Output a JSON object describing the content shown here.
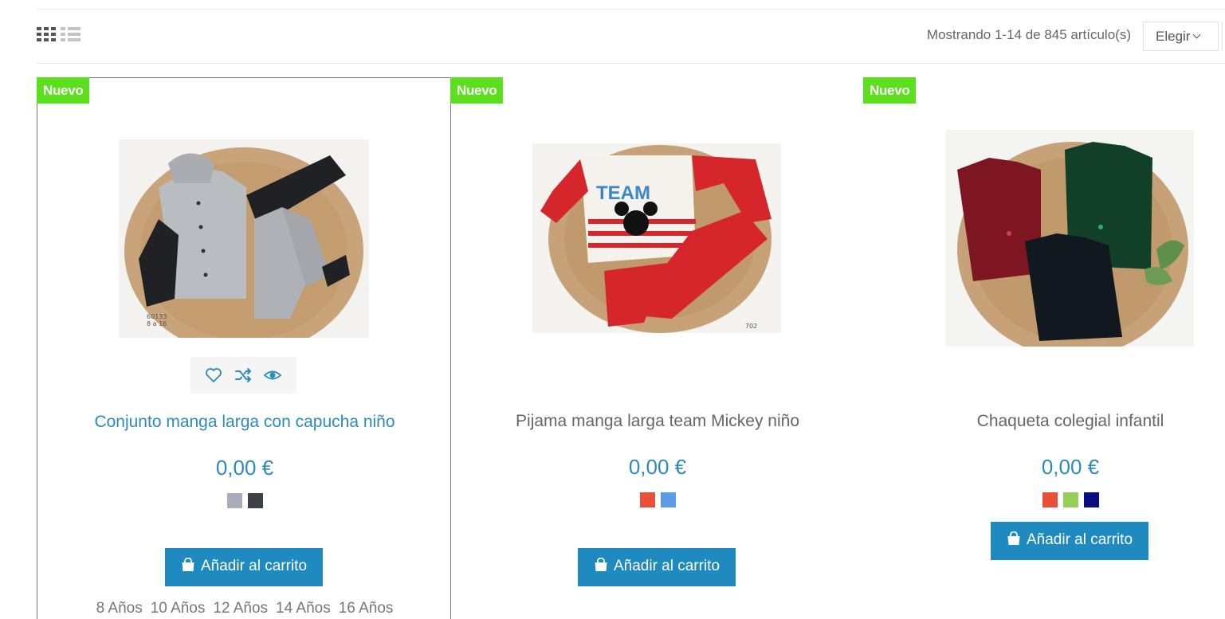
{
  "toolbar": {
    "showing_text": "Mostrando 1-14 de 845 artículo(s)",
    "sort_label": "Elegir",
    "grid_view_icon": "grid-view-icon",
    "list_view_icon": "list-view-icon"
  },
  "colors": {
    "accent": "#2a8cbc",
    "button": "#1f8ac0",
    "badge": "#5ce01d"
  },
  "products": [
    {
      "badge": "Nuevo",
      "title": "Conjunto manga larga con capucha niño",
      "price": "0,00 €",
      "swatches": [
        "#a9adb8",
        "#3d4148"
      ],
      "cart_label": "Añadir al carrito",
      "sizes": [
        "8 Años",
        "10 Años",
        "12 Años",
        "14 Años",
        "16 Años"
      ],
      "photo_tag": "60133\n8 a 16",
      "actions": [
        "heart-icon",
        "shuffle-icon",
        "eye-icon"
      ]
    },
    {
      "badge": "Nuevo",
      "title": "Pijama manga larga team Mickey niño",
      "price": "0,00 €",
      "swatches": [
        "#e8503a",
        "#5b9be8"
      ],
      "cart_label": "Añadir al carrito",
      "photo_tag": "702"
    },
    {
      "badge": "Nuevo",
      "title": "Chaqueta colegial infantil",
      "price": "0,00 €",
      "swatches": [
        "#e8503a",
        "#95cf5a",
        "#0b0b80"
      ],
      "cart_label": "Añadir al carrito"
    }
  ]
}
